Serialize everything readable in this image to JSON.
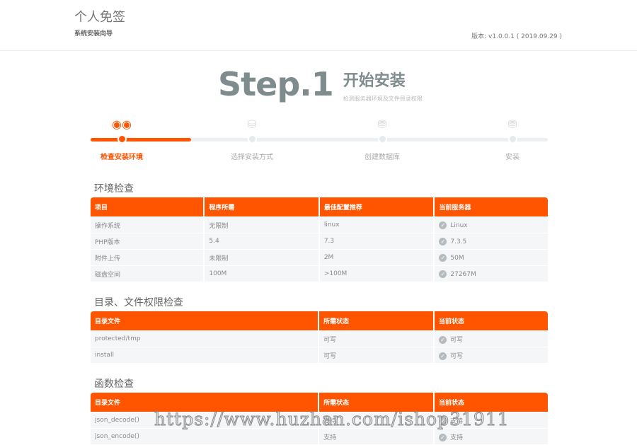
{
  "header": {
    "title": "个人免签",
    "subtitle": "系统安装向导",
    "version": "版本: v1.0.0.1 ( 2019.09.29 )"
  },
  "step": {
    "big": "Step.1",
    "name": "开始安装",
    "desc": "检测服务器环境及文件目录权限",
    "progress_percent": 22
  },
  "steps": [
    {
      "label": "检查安装环境",
      "icon": "binoculars-icon"
    },
    {
      "label": "选择安装方式",
      "icon": "coins-icon"
    },
    {
      "label": "创建数据库",
      "icon": "database-search-icon"
    },
    {
      "label": "安装",
      "icon": "database-check-icon"
    }
  ],
  "env": {
    "title": "环境检查",
    "headers": [
      "项目",
      "程序所需",
      "最佳配置推荐",
      "当前服务器"
    ],
    "rows": [
      [
        "操作系统",
        "无限制",
        "linux",
        "Linux"
      ],
      [
        "PHP版本",
        "5.4",
        "7.3",
        "7.3.5"
      ],
      [
        "附件上传",
        "未限制",
        "2M",
        "50M"
      ],
      [
        "磁盘空间",
        "100M",
        ">100M",
        "27267M"
      ]
    ]
  },
  "dirs": {
    "title": "目录、文件权限检查",
    "headers": [
      "目录文件",
      "所需状态",
      "当前状态"
    ],
    "rows": [
      [
        "protected/tmp",
        "可写",
        "可写"
      ],
      [
        "install",
        "可写",
        "可写"
      ]
    ]
  },
  "funcs": {
    "title": "函数检查",
    "headers": [
      "目录文件",
      "所需状态",
      "当前状态"
    ],
    "rows": [
      [
        "json_decode()",
        "支持",
        "支持"
      ],
      [
        "json_encode()",
        "支持",
        "支持"
      ]
    ]
  },
  "watermark": "https://www.huzhan.com/ishop31911"
}
